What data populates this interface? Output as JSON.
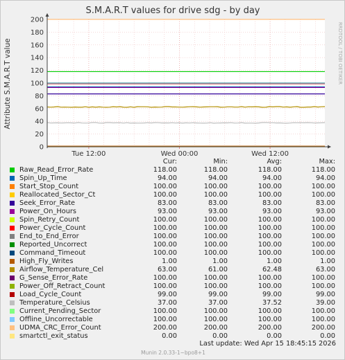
{
  "chart_data": {
    "type": "line",
    "title": "S.M.A.R.T values for drive sdg - by day",
    "ylabel": "Attribute S.M.A.R.T value",
    "watermark": "RRDTOOL / TOBI OETIKER",
    "ylim": [
      0,
      200
    ],
    "yticks": [
      0,
      20,
      40,
      60,
      80,
      100,
      120,
      140,
      160,
      180,
      200
    ],
    "xlim": [
      "2026-04-14 06:30",
      "2026-04-15 19:15"
    ],
    "xticks": [
      {
        "label": "Tue 12:00",
        "at": "2026-04-14 12:00"
      },
      {
        "label": "Wed 00:00",
        "at": "2026-04-15 00:00"
      },
      {
        "label": "Wed 12:00",
        "at": "2026-04-15 12:00"
      }
    ],
    "grid": true,
    "columns": [
      "Cur:",
      "Min:",
      "Avg:",
      "Max:"
    ],
    "series": [
      {
        "name": "Raw_Read_Error_Rate",
        "color": "#00cc00",
        "cur": "118.00",
        "min": "118.00",
        "avg": "118.00",
        "max": "118.00",
        "value": 118
      },
      {
        "name": "Spin_Up_Time",
        "color": "#0066b3",
        "cur": "94.00",
        "min": "94.00",
        "avg": "94.00",
        "max": "94.00",
        "value": 94
      },
      {
        "name": "Start_Stop_Count",
        "color": "#ff8000",
        "cur": "100.00",
        "min": "100.00",
        "avg": "100.00",
        "max": "100.00",
        "value": 100
      },
      {
        "name": "Reallocated_Sector_Ct",
        "color": "#ffcc00",
        "cur": "100.00",
        "min": "100.00",
        "avg": "100.00",
        "max": "100.00",
        "value": 100
      },
      {
        "name": "Seek_Error_Rate",
        "color": "#330099",
        "cur": "83.00",
        "min": "83.00",
        "avg": "83.00",
        "max": "83.00",
        "value": 83
      },
      {
        "name": "Power_On_Hours",
        "color": "#990099",
        "cur": "93.00",
        "min": "93.00",
        "avg": "93.00",
        "max": "93.00",
        "value": 93
      },
      {
        "name": "Spin_Retry_Count",
        "color": "#ccff00",
        "cur": "100.00",
        "min": "100.00",
        "avg": "100.00",
        "max": "100.00",
        "value": 100
      },
      {
        "name": "Power_Cycle_Count",
        "color": "#ff0000",
        "cur": "100.00",
        "min": "100.00",
        "avg": "100.00",
        "max": "100.00",
        "value": 100
      },
      {
        "name": "End_to_End_Error",
        "color": "#808080",
        "cur": "100.00",
        "min": "100.00",
        "avg": "100.00",
        "max": "100.00",
        "value": 100
      },
      {
        "name": "Reported_Uncorrect",
        "color": "#008f00",
        "cur": "100.00",
        "min": "100.00",
        "avg": "100.00",
        "max": "100.00",
        "value": 100
      },
      {
        "name": "Command_Timeout",
        "color": "#00487d",
        "cur": "100.00",
        "min": "100.00",
        "avg": "100.00",
        "max": "100.00",
        "value": 100
      },
      {
        "name": "High_Fly_Writes",
        "color": "#b35a00",
        "cur": "1.00",
        "min": "1.00",
        "avg": "1.00",
        "max": "1.00",
        "value": 1
      },
      {
        "name": "Airflow_Temperature_Cel",
        "color": "#b38f00",
        "cur": "63.00",
        "min": "61.00",
        "avg": "62.48",
        "max": "63.00",
        "value": 62.5,
        "wiggle": true
      },
      {
        "name": "G_Sense_Error_Rate",
        "color": "#6b006b",
        "cur": "100.00",
        "min": "100.00",
        "avg": "100.00",
        "max": "100.00",
        "value": 100
      },
      {
        "name": "Power_Off_Retract_Count",
        "color": "#8fb300",
        "cur": "100.00",
        "min": "100.00",
        "avg": "100.00",
        "max": "100.00",
        "value": 100
      },
      {
        "name": "Load_Cycle_Count",
        "color": "#b30000",
        "cur": "99.00",
        "min": "99.00",
        "avg": "99.00",
        "max": "99.00",
        "value": 99
      },
      {
        "name": "Temperature_Celsius",
        "color": "#bebebe",
        "cur": "37.00",
        "min": "37.00",
        "avg": "37.52",
        "max": "39.00",
        "value": 37.5,
        "wiggle": true
      },
      {
        "name": "Current_Pending_Sector",
        "color": "#80ff80",
        "cur": "100.00",
        "min": "100.00",
        "avg": "100.00",
        "max": "100.00",
        "value": 100
      },
      {
        "name": "Offline_Uncorrectable",
        "color": "#80c9ff",
        "cur": "100.00",
        "min": "100.00",
        "avg": "100.00",
        "max": "100.00",
        "value": 100
      },
      {
        "name": "UDMA_CRC_Error_Count",
        "color": "#ffc080",
        "cur": "200.00",
        "min": "200.00",
        "avg": "200.00",
        "max": "200.00",
        "value": 200
      },
      {
        "name": "smartctl_exit_status",
        "color": "#ffe680",
        "cur": "0.00",
        "min": "0.00",
        "avg": "0.00",
        "max": "0.00",
        "value": 0
      }
    ]
  },
  "last_update": "Last update:  Wed Apr 15 18:45:15 2026",
  "footer": "Munin 2.0.33-1~bpo8+1"
}
